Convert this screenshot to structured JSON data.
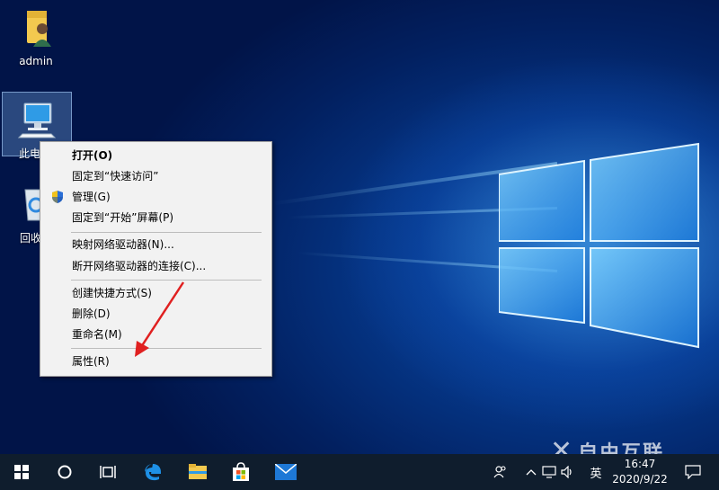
{
  "desktop": {
    "icons": [
      {
        "label": "admin",
        "icon": "user-folder-icon"
      },
      {
        "label": "此电",
        "icon": "this-pc-icon"
      },
      {
        "label": "回收",
        "icon": "recycle-bin-icon"
      }
    ]
  },
  "context_menu": {
    "items": [
      {
        "label": "打开(O)",
        "bold": true
      },
      {
        "label": "固定到“快速访问”"
      },
      {
        "label": "管理(G)",
        "icon": "shield-icon"
      },
      {
        "label": "固定到“开始”屏幕(P)"
      },
      {
        "label": "映射网络驱动器(N)..."
      },
      {
        "label": "断开网络驱动器的连接(C)..."
      },
      {
        "label": "创建快捷方式(S)"
      },
      {
        "label": "删除(D)"
      },
      {
        "label": "重命名(M)"
      },
      {
        "label": "属性(R)"
      }
    ]
  },
  "taskbar": {
    "buttons": [
      "start-icon",
      "search-circle-icon",
      "task-view-icon",
      "edge-icon",
      "file-explorer-icon",
      "store-icon",
      "mail-icon"
    ],
    "tray": {
      "input_language": "英",
      "time": "16:47",
      "date": "2020/9/22"
    }
  },
  "watermark": "自由互联",
  "colors": {
    "menu_bg": "#f2f2f2",
    "taskbar_bg": "#0f1d2d",
    "annotation_arrow": "#e02020",
    "accent": "#0a62c7"
  }
}
